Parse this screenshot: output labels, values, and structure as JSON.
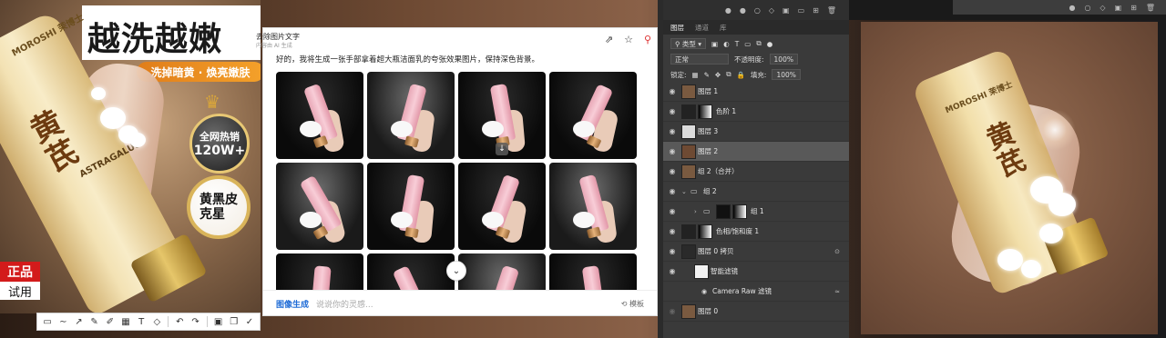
{
  "poster": {
    "title": "越洗越嫩",
    "subtitle": "洗掉暗黄 · 焕亮嫩肤",
    "brand": "MOROSHI 茉博士",
    "product_name": "黄芪",
    "latin": "ASTRAGALUS",
    "badge_sales_line1": "全网热销",
    "badge_sales_line2": "120W+",
    "badge_star": "黄黑皮\n克星",
    "tag_red": "正品",
    "tag_white": "试用"
  },
  "snip_toolbar": {
    "tools": [
      "rect-select-icon",
      "line-icon",
      "arrow-icon",
      "pen-icon",
      "highlighter-icon",
      "mosaic-icon",
      "text-icon",
      "eraser-icon",
      "undo-icon",
      "redo-icon",
      "save-icon",
      "copy-icon",
      "done-icon"
    ]
  },
  "chat": {
    "title": "去除图片文字",
    "meta": "内容由 AI 生成",
    "message": "好的，我将生成一张手部拿着超大瓶洁面乳的夸张效果图片，保持深色背景。",
    "input_mode": "图像生成",
    "input_placeholder": "说说你的灵感...",
    "template_label": "模板",
    "icons": {
      "share": "share-icon",
      "star": "star-icon",
      "pin": "pin-icon"
    }
  },
  "photoshop": {
    "tabs": [
      "图层",
      "通道",
      "库"
    ],
    "filter_type": "类型",
    "blend_mode": "正常",
    "opacity_label": "不透明度:",
    "opacity_value": "100%",
    "lock_label": "锁定:",
    "fill_label": "填充:",
    "fill_value": "100%",
    "layers": [
      {
        "name": "图层 1",
        "kind": "image"
      },
      {
        "name": "色阶 1",
        "kind": "adjust"
      },
      {
        "name": "图层 3",
        "kind": "empty"
      },
      {
        "name": "图层 2",
        "kind": "solid",
        "selected": true
      },
      {
        "name": "组 2（合并）",
        "kind": "image"
      },
      {
        "name": "组 2",
        "kind": "group"
      },
      {
        "name": "组 1",
        "kind": "group-child"
      },
      {
        "name": "色相/饱和度 1",
        "kind": "adjust"
      },
      {
        "name": "图层 0 拷贝",
        "kind": "smart"
      },
      {
        "name": "智能滤镜",
        "kind": "filter"
      },
      {
        "name": "Camera Raw 滤镜",
        "kind": "filter-item"
      },
      {
        "name": "图层 0",
        "kind": "image"
      }
    ]
  },
  "colors": {
    "accent_blue": "#1e6bd6",
    "badge_orange": "#e07d1a",
    "tag_red": "#d31b1b",
    "ps_panel": "#3a3a3a",
    "ps_selected": "#595959"
  }
}
